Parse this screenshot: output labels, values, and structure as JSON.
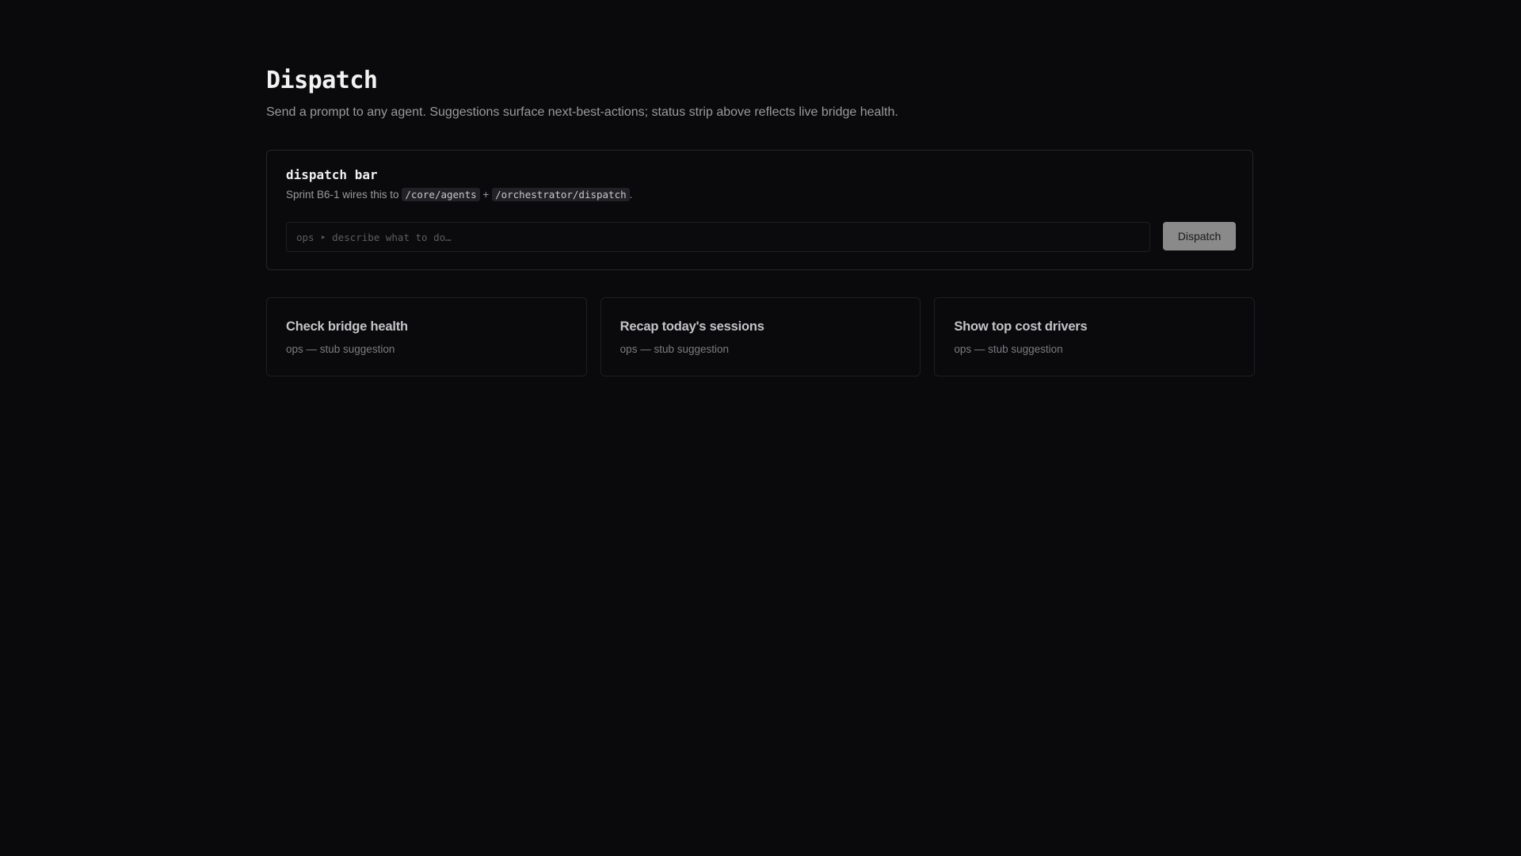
{
  "header": {
    "title": "Dispatch",
    "subtitle": "Send a prompt to any agent. Suggestions surface next-best-actions; status strip above reflects live bridge health."
  },
  "dispatch_bar": {
    "title": "dispatch bar",
    "desc_prefix": "Sprint B6-1 wires this to",
    "endpoint_1": "/core/agents",
    "joiner": "+",
    "endpoint_2": "/orchestrator/dispatch",
    "desc_suffix": ".",
    "input_placeholder": "ops ‣ describe what to do…",
    "input_value": "",
    "button_label": "Dispatch"
  },
  "suggestions": [
    {
      "title": "Check bridge health",
      "subtitle": "ops — stub suggestion"
    },
    {
      "title": "Recap today's sessions",
      "subtitle": "ops — stub suggestion"
    },
    {
      "title": "Show top cost drivers",
      "subtitle": "ops — stub suggestion"
    }
  ]
}
